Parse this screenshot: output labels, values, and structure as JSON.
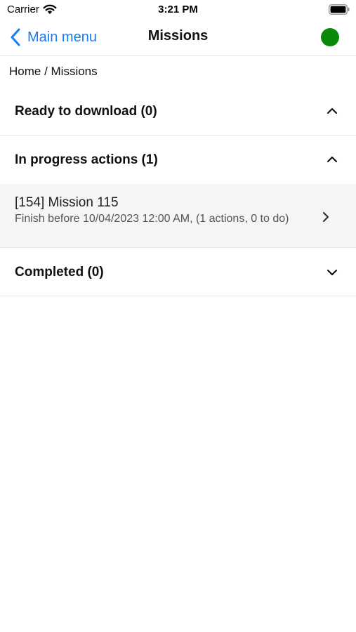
{
  "status_bar": {
    "carrier": "Carrier",
    "time": "3:21 PM"
  },
  "nav": {
    "back_label": "Main menu",
    "title": "Missions",
    "status_color": "#0a8a0a",
    "accent_color": "#1a7cf2"
  },
  "breadcrumb": "Home / Missions",
  "sections": [
    {
      "title": "Ready to download (0)",
      "state": "expanded"
    },
    {
      "title": "In progress actions (1)",
      "state": "expanded"
    },
    {
      "title": "Completed (0)",
      "state": "collapsed"
    }
  ],
  "missions": [
    {
      "title": "[154] Mission 115",
      "subtitle": "Finish before 10/04/2023 12:00 AM, (1 actions, 0 to do)"
    }
  ],
  "icons": {
    "wifi": "wifi-icon",
    "battery": "battery-icon",
    "back": "chevron-left-icon",
    "expanded": "chevron-up-icon",
    "collapsed": "chevron-down-icon",
    "row": "chevron-right-icon"
  }
}
